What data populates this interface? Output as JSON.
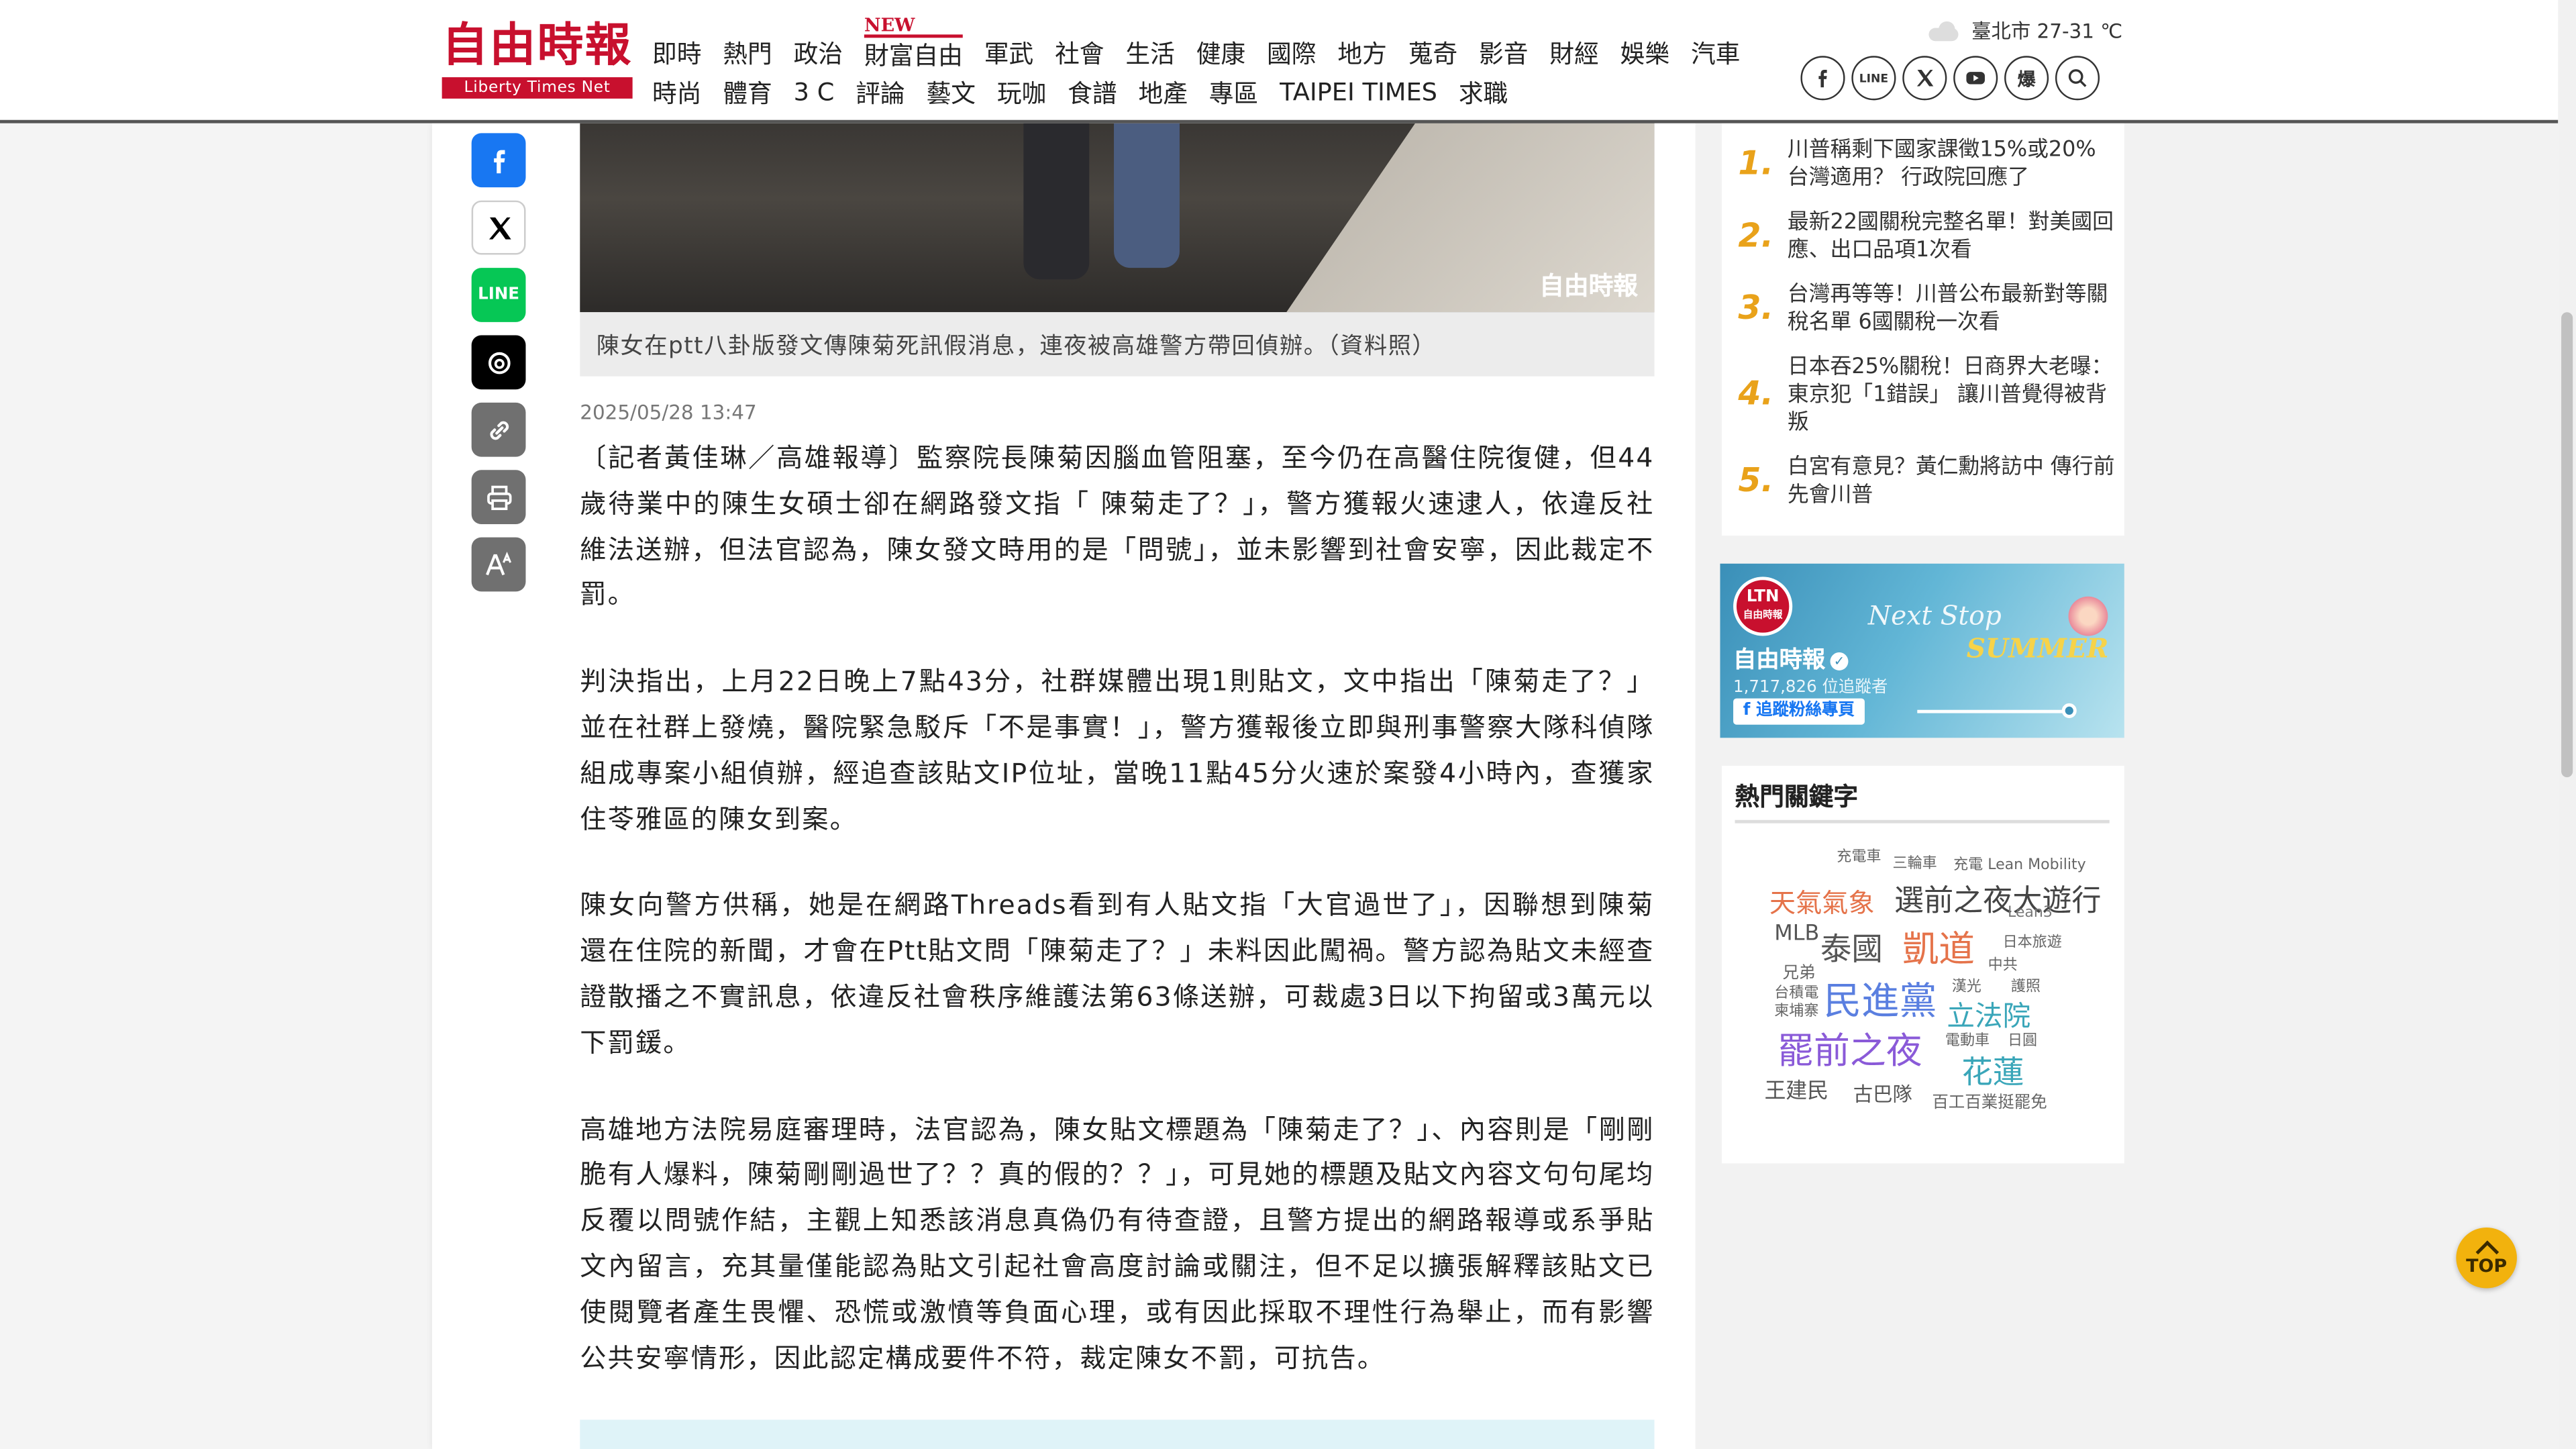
{
  "site": {
    "logo_cn": "自由時報",
    "logo_en": "Liberty Times Net"
  },
  "nav": {
    "new_badge": "NEW",
    "row1": [
      "即時",
      "熱門",
      "政治",
      "財富自由",
      "軍武",
      "社會",
      "生活",
      "健康",
      "國際",
      "地方",
      "蒐奇",
      "影音",
      "財經",
      "娛樂",
      "汽車"
    ],
    "row2": [
      "時尚",
      "體育",
      "3 C",
      "評論",
      "藝文",
      "玩咖",
      "食譜",
      "地產",
      "專區",
      "TAIPEI TIMES",
      "求職"
    ]
  },
  "weather": {
    "text": "臺北市 27-31 ℃"
  },
  "social_icons": [
    "facebook-icon",
    "line-icon",
    "x-icon",
    "youtube-icon",
    "bao-icon",
    "search-icon"
  ],
  "social_labels": {
    "line": "LINE",
    "bao": "爆"
  },
  "share": {
    "line_label": "LINE"
  },
  "photo": {
    "watermark": "自由時報",
    "caption": "陳女在ptt八卦版發文傳陳菊死訊假消息，連夜被高雄警方帶回偵辦。（資料照）"
  },
  "article": {
    "date": "2025/05/28 13:47",
    "paragraphs": [
      "〔記者黃佳琳／高雄報導〕監察院長陳菊因腦血管阻塞，至今仍在高醫住院復健，但44歲待業中的陳生女碩士卻在網路發文指「 陳菊走了？」，警方獲報火速逮人，依違反社維法送辦，但法官認為，陳女發文時用的是「問號」，並未影響到社會安寧，因此裁定不罰。",
      "判決指出，上月22日晚上7點43分，社群媒體出現1則貼文，文中指出「陳菊走了？」並在社群上發燒，醫院緊急駁斥「不是事實！」，警方獲報後立即與刑事警察大隊科偵隊組成專案小組偵辦，經追查該貼文IP位址，當晚11點45分火速於案發4小時內，查獲家住苓雅區的陳女到案。",
      "陳女向警方供稱，她是在網路Threads看到有人貼文指「大官過世了」，因聯想到陳菊還在住院的新聞，才會在Ptt貼文問「陳菊走了？」未料因此闖禍。警方認為貼文未經查證散播之不實訊息，依違反社會秩序維護法第63條送辦，可裁處3日以下拘留或3萬元以下罰鍰。",
      "高雄地方法院易庭審理時，法官認為，陳女貼文標題為「陳菊走了？」、內容則是「剛剛脆有人爆料，陳菊剛剛過世了？？真的假的？？」，可見她的標題及貼文內容文句句尾均反覆以問號作結，主觀上知悉該消息真偽仍有待查證，且警方提出的網路報導或系爭貼文內留言，充其量僅能認為貼文引起社會高度討論或關注，但不足以擴張解釋該貼文已使閱覽者產生畏懼、恐慌或激憤等負面心理，或有因此採取不理性行為舉止，而有影響公共安寧情形，因此認定構成要件不符，裁定陳女不罰，可抗告。"
    ]
  },
  "ranking": {
    "items": [
      {
        "num": "1.",
        "text": "川普稱剩下國家課徵15%或20% 台灣適用？ 行政院回應了"
      },
      {
        "num": "2.",
        "text": "最新22國關稅完整名單！對美國回應、出口品項1次看"
      },
      {
        "num": "3.",
        "text": "台灣再等等！川普公布最新對等關稅名單 6國關稅一次看"
      },
      {
        "num": "4.",
        "text": "日本吞25%關稅！日商界大老曝：東京犯「1錯誤」 讓川普覺得被背叛"
      },
      {
        "num": "5.",
        "text": "白宮有意見？黃仁勳將訪中 傳行前先會川普"
      }
    ]
  },
  "fb_banner": {
    "logo_top": "LTN",
    "logo_bottom": "自由時報",
    "name": "自由時報",
    "followers": "1,717,826 位追蹤者",
    "follow_button": "追蹤粉絲專頁",
    "slogan_1": "Next Stop",
    "slogan_2": "SUMMER"
  },
  "keywords": {
    "title": "熱門關鍵字",
    "items": [
      {
        "text": "充電車",
        "color": "#666666"
      },
      {
        "text": "三輪車",
        "color": "#666666"
      },
      {
        "text": "充電 Lean Mobility",
        "color": "#666666"
      },
      {
        "text": "天氣氣象",
        "color": "#e5734a"
      },
      {
        "text": "選前之夜大遊行",
        "color": "#444444"
      },
      {
        "text": "Lean3",
        "color": "#777777"
      },
      {
        "text": "MLB",
        "color": "#555555"
      },
      {
        "text": "泰國",
        "color": "#555555"
      },
      {
        "text": "凱道",
        "color": "#e5734a"
      },
      {
        "text": "日本旅遊",
        "color": "#666666"
      },
      {
        "text": "中共",
        "color": "#666666"
      },
      {
        "text": "兄弟",
        "color": "#666666"
      },
      {
        "text": "台積電",
        "color": "#666666"
      },
      {
        "text": "柬埔寨",
        "color": "#666666"
      },
      {
        "text": "民進黨",
        "color": "#5a7fe0"
      },
      {
        "text": "漢光",
        "color": "#666666"
      },
      {
        "text": "護照",
        "color": "#666666"
      },
      {
        "text": "立法院",
        "color": "#3aa6b9"
      },
      {
        "text": "罷前之夜",
        "color": "#8a5ad8"
      },
      {
        "text": "電動車",
        "color": "#666666"
      },
      {
        "text": "日圓",
        "color": "#666666"
      },
      {
        "text": "花蓮",
        "color": "#3aa6b9"
      },
      {
        "text": "王建民",
        "color": "#555555"
      },
      {
        "text": "古巴隊",
        "color": "#555555"
      },
      {
        "text": "百工百業挺罷免",
        "color": "#666666"
      }
    ]
  },
  "top_button": {
    "label": "TOP"
  },
  "colors": {
    "brand_red": "#c8102e",
    "rank_number": "#e9a21a",
    "top_button": "#f2b20d"
  }
}
